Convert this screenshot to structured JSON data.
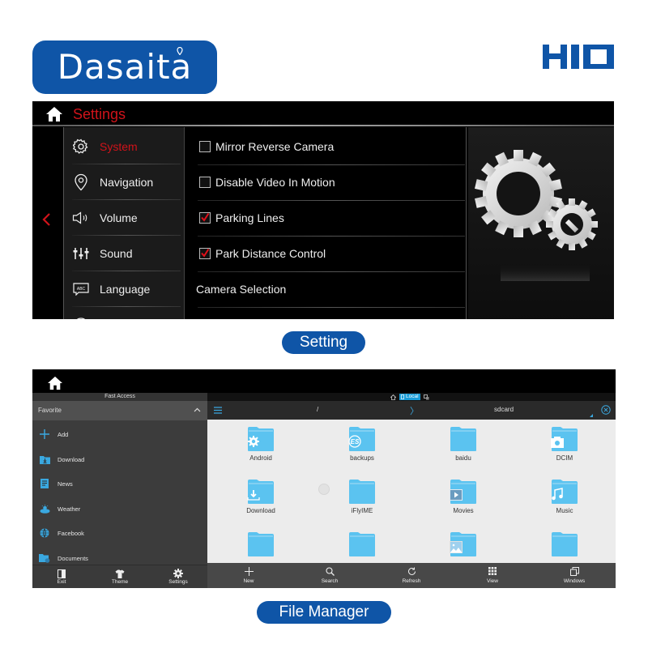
{
  "brand": {
    "logo_text": "Dasaita",
    "model_badge": "H10",
    "accent_color": "#0f55a7"
  },
  "settings_screen": {
    "title": "Settings",
    "title_color": "#d0131a",
    "back_icon": "chevron-left-icon",
    "home_icon": "home-icon",
    "menu": [
      {
        "label": "System",
        "icon": "gear-icon",
        "active": true
      },
      {
        "label": "Navigation",
        "icon": "location-pin-icon",
        "active": false
      },
      {
        "label": "Volume",
        "icon": "speaker-icon",
        "active": false
      },
      {
        "label": "Sound",
        "icon": "equalizer-icon",
        "active": false
      },
      {
        "label": "Language",
        "icon": "abc-keyboard-icon",
        "active": false
      }
    ],
    "options": [
      {
        "label": "Mirror Reverse Camera",
        "type": "checkbox",
        "checked": false
      },
      {
        "label": "Disable Video In Motion",
        "type": "checkbox",
        "checked": false
      },
      {
        "label": "Parking Lines",
        "type": "checkbox",
        "checked": true
      },
      {
        "label": "Park Distance Control",
        "type": "checkbox",
        "checked": true
      },
      {
        "label": "Camera Selection",
        "type": "link"
      }
    ],
    "art_icon": "gears-icon"
  },
  "captions": {
    "setting": "Setting",
    "file_manager": "File Manager"
  },
  "file_manager": {
    "sidebar": {
      "header": "Fast Access",
      "section": "Favorite",
      "items": [
        {
          "label": "Add",
          "icon": "plus-icon"
        },
        {
          "label": "Download",
          "icon": "download-folder-icon"
        },
        {
          "label": "News",
          "icon": "news-icon"
        },
        {
          "label": "Weather",
          "icon": "weather-icon"
        },
        {
          "label": "Facebook",
          "icon": "globe-icon"
        },
        {
          "label": "Documents",
          "icon": "documents-icon"
        }
      ],
      "bottom_buttons": [
        {
          "label": "Exit",
          "icon": "exit-icon"
        },
        {
          "label": "Theme",
          "icon": "shirt-icon"
        },
        {
          "label": "Settings",
          "icon": "gear-icon"
        }
      ]
    },
    "status": {
      "location_tab": "Local"
    },
    "path": {
      "root": "/",
      "separator": "〉",
      "current": "sdcard"
    },
    "folders": [
      {
        "name": "Android",
        "overlay": "gear"
      },
      {
        "name": "backups",
        "overlay": "es"
      },
      {
        "name": "baidu",
        "overlay": ""
      },
      {
        "name": "DCIM",
        "overlay": "camera"
      },
      {
        "name": "Download",
        "overlay": "download"
      },
      {
        "name": "iFlyIME",
        "overlay": ""
      },
      {
        "name": "Movies",
        "overlay": "play"
      },
      {
        "name": "Music",
        "overlay": "music"
      },
      {
        "name": "",
        "overlay": ""
      },
      {
        "name": "",
        "overlay": ""
      },
      {
        "name": "",
        "overlay": "picture"
      },
      {
        "name": "",
        "overlay": ""
      }
    ],
    "toolbar": [
      {
        "label": "New",
        "icon": "plus-icon"
      },
      {
        "label": "Search",
        "icon": "search-icon"
      },
      {
        "label": "Refresh",
        "icon": "refresh-icon"
      },
      {
        "label": "View",
        "icon": "grid-icon"
      },
      {
        "label": "Windows",
        "icon": "windows-icon"
      }
    ],
    "folder_color": "#5bc3f0",
    "accent_color": "#1a9dd8"
  }
}
